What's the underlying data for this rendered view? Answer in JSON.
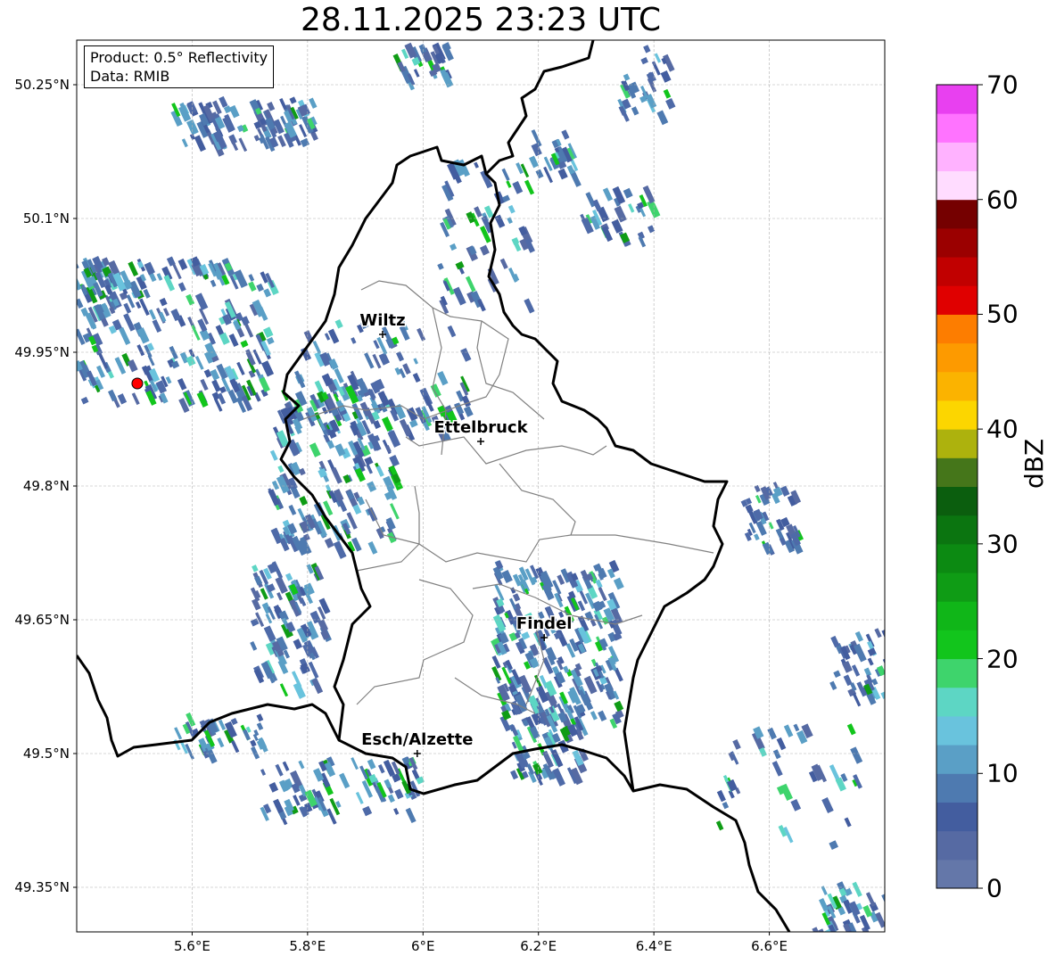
{
  "title": "28.11.2025 23:23 UTC",
  "info": {
    "product": "Product: 0.5° Reflectivity",
    "data": "Data: RMIB"
  },
  "axes": {
    "lat_ticks": [
      "50.25°N",
      "50.1°N",
      "49.95°N",
      "49.8°N",
      "49.65°N",
      "49.5°N",
      "49.35°N"
    ],
    "lon_ticks": [
      "5.6°E",
      "5.8°E",
      "6°E",
      "6.2°E",
      "6.4°E",
      "6.6°E"
    ],
    "lat_values": [
      50.25,
      50.1,
      49.95,
      49.8,
      49.65,
      49.5,
      49.35
    ],
    "lon_values": [
      5.6,
      5.8,
      6.0,
      6.2,
      6.4,
      6.6
    ],
    "lat_range": [
      49.3,
      50.3
    ],
    "lon_range": [
      5.4,
      6.8
    ],
    "grid": true
  },
  "cities": [
    {
      "name": "Wiltz",
      "lat": 49.97,
      "lon": 5.93
    },
    {
      "name": "Ettelbruck",
      "lat": 49.85,
      "lon": 6.1
    },
    {
      "name": "Findel",
      "lat": 49.63,
      "lon": 6.21
    },
    {
      "name": "Esch/Alzette",
      "lat": 49.5,
      "lon": 5.99
    }
  ],
  "radar_site": {
    "lat": 49.915,
    "lon": 5.505,
    "color": "#ff0000"
  },
  "colorbar": {
    "label": "dBZ",
    "ticks": [
      "70",
      "60",
      "50",
      "40",
      "30",
      "20",
      "10",
      "0"
    ],
    "tick_values": [
      70,
      60,
      50,
      40,
      30,
      20,
      10,
      0
    ],
    "range": [
      0,
      70
    ],
    "colors": [
      "#6477a9",
      "#566aa3",
      "#435d9f",
      "#4e7ab0",
      "#5a9fc6",
      "#69c3dd",
      "#5dd6c4",
      "#3ed46c",
      "#12c51c",
      "#10b618",
      "#0f9c15",
      "#0c8a12",
      "#0b7510",
      "#0b5e0e",
      "#45761a",
      "#adb20d",
      "#fcd600",
      "#fbb300",
      "#fd9a00",
      "#fd7d00",
      "#e00000",
      "#c10000",
      "#9b0000",
      "#750000",
      "#ffdcff",
      "#ffb2ff",
      "#ff73ff",
      "#e840f0"
    ]
  }
}
